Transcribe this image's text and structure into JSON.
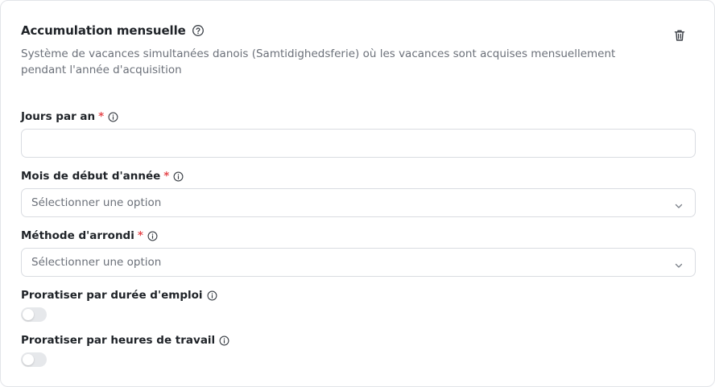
{
  "card": {
    "title": "Accumulation mensuelle",
    "description": "Système de vacances simultanées danois (Samtidighedsferie) où les vacances sont acquises mensuellement pendant l'année d'acquisition"
  },
  "fields": {
    "jours_par_an": {
      "label": "Jours par an",
      "required": "*",
      "value": "",
      "placeholder": ""
    },
    "mois_debut": {
      "label": "Mois de début d'année",
      "required": "*",
      "selected": "Sélectionner une option"
    },
    "methode_arrondi": {
      "label": "Méthode d'arrondi",
      "required": "*",
      "selected": "Sélectionner une option"
    },
    "proratiser_duree": {
      "label": "Proratiser par durée d'emploi",
      "enabled": false
    },
    "proratiser_heures": {
      "label": "Proratiser par heures de travail",
      "enabled": false
    }
  },
  "icons": {
    "help": "help-circle-icon",
    "info": "info-icon",
    "delete": "trash-icon",
    "dropdown": "chevron-down-icon"
  },
  "colors": {
    "required": "#e5484d",
    "muted_text": "#6b7079",
    "border": "#d9dce1",
    "toggle_off": "#e6e8eb"
  }
}
